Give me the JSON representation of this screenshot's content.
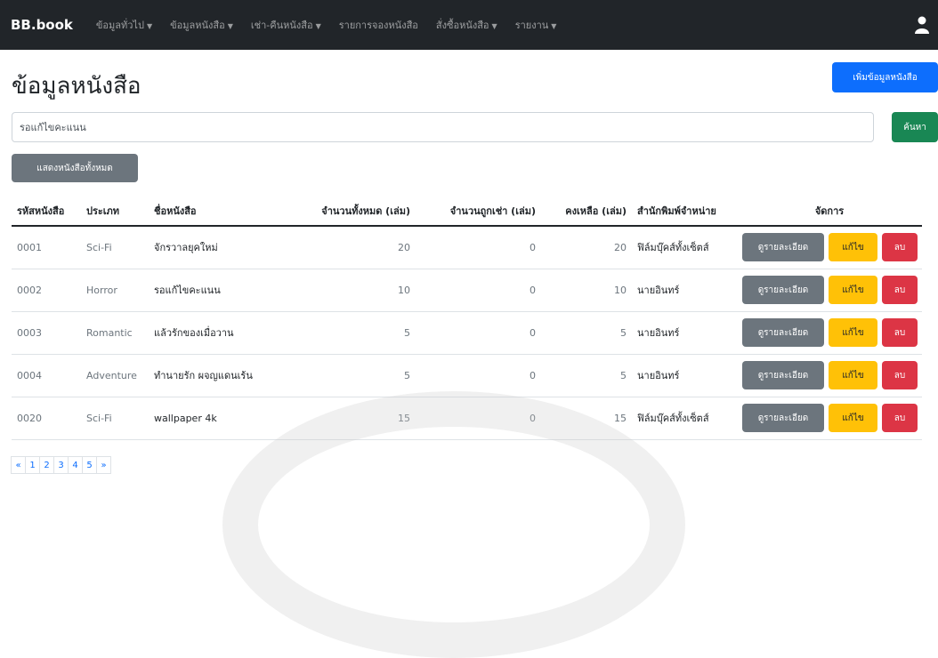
{
  "navbar": {
    "brand": "BB.book",
    "items": [
      {
        "label": "ข้อมูลทั่วไป",
        "dropdown": true
      },
      {
        "label": "ข้อมูลหนังสือ",
        "dropdown": true
      },
      {
        "label": "เช่า-คืนหนังสือ",
        "dropdown": true
      },
      {
        "label": "รายการจองหนังสือ",
        "dropdown": false
      },
      {
        "label": "สั่งซื้อหนังสือ",
        "dropdown": true
      },
      {
        "label": "รายงาน",
        "dropdown": true
      }
    ],
    "user_icon": "user-icon"
  },
  "page": {
    "title": "ข้อมูลหนังสือ",
    "add_button": "เพิ่มข้อมูลหนังสือ",
    "search": {
      "value": "รอแก้ไขคะแนน",
      "button": "ค้นหา"
    },
    "show_all_button": "แสดงหนังสือทั้งหมด"
  },
  "table": {
    "headers": [
      "รหัสหนังสือ",
      "ประเภท",
      "ชื่อหนังสือ",
      "จำนวนทั้งหมด (เล่ม)",
      "จำนวนถูกเช่า (เล่ม)",
      "คงเหลือ (เล่ม)",
      "สำนักพิมพ์จำหน่าย",
      "จัดการ"
    ],
    "rows": [
      {
        "id": "0001",
        "type": "Sci-Fi",
        "name": "จักรวาลยุคใหม่",
        "total": "20",
        "rented": "0",
        "remaining": "20",
        "publisher": "ฟิล์มบุ๊คส์ทั้งเซ็ตส์"
      },
      {
        "id": "0002",
        "type": "Horror",
        "name": "รอแก้ไขคะแนน",
        "total": "10",
        "rented": "0",
        "remaining": "10",
        "publisher": "นายอินทร์"
      },
      {
        "id": "0003",
        "type": "Romantic",
        "name": "แล้วรักของเมื่อวาน",
        "total": "5",
        "rented": "0",
        "remaining": "5",
        "publisher": "นายอินทร์"
      },
      {
        "id": "0004",
        "type": "Adventure",
        "name": "ทำนายรัก ผจญแดนเร้น",
        "total": "5",
        "rented": "0",
        "remaining": "5",
        "publisher": "นายอินทร์"
      },
      {
        "id": "0020",
        "type": "Sci-Fi",
        "name": "wallpaper 4k",
        "total": "15",
        "rented": "0",
        "remaining": "15",
        "publisher": "ฟิล์มบุ๊คส์ทั้งเซ็ตส์"
      }
    ],
    "action_labels": {
      "detail": "ดูรายละเอียด",
      "edit": "แก้ไข",
      "delete": "ลบ"
    }
  },
  "pagination": [
    "«",
    "1",
    "2",
    "3",
    "4",
    "5",
    "»"
  ],
  "colors": {
    "navbar": "#212529",
    "primary": "#0d6efd",
    "success": "#198754",
    "secondary": "#6c757d",
    "warning": "#ffc107",
    "danger": "#dc3545"
  }
}
